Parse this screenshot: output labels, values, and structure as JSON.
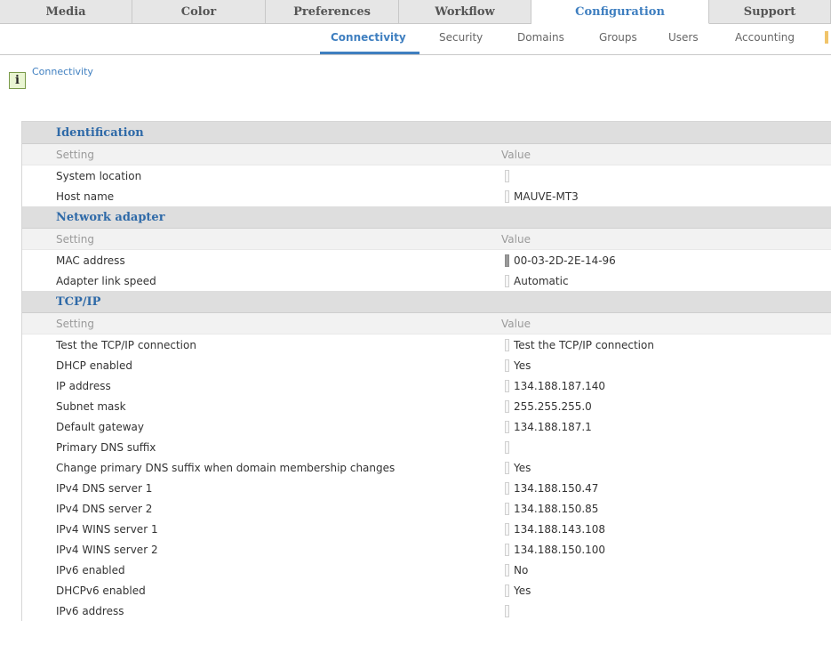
{
  "top_tabs": [
    {
      "label": "Media"
    },
    {
      "label": "Color"
    },
    {
      "label": "Preferences"
    },
    {
      "label": "Workflow"
    },
    {
      "label": "Configuration"
    },
    {
      "label": "Support"
    }
  ],
  "sub_tabs": [
    {
      "label": "Connectivity"
    },
    {
      "label": "Security"
    },
    {
      "label": "Domains"
    },
    {
      "label": "Groups"
    },
    {
      "label": "Users"
    },
    {
      "label": "Accounting"
    }
  ],
  "breadcrumb": "Connectivity",
  "info_icon_glyph": "i",
  "column_headers": {
    "setting": "Setting",
    "value": "Value"
  },
  "sections": [
    {
      "title": "Identification",
      "rows": [
        {
          "label": "System location",
          "value": ""
        },
        {
          "label": "Host name",
          "value": "MAUVE-MT3"
        }
      ]
    },
    {
      "title": "Network adapter",
      "rows": [
        {
          "label": "MAC address",
          "value": "00-03-2D-2E-14-96"
        },
        {
          "label": "Adapter link speed",
          "value": "Automatic"
        }
      ]
    },
    {
      "title": "TCP/IP",
      "rows": [
        {
          "label": "Test the TCP/IP connection",
          "value": "Test the TCP/IP connection"
        },
        {
          "label": "DHCP enabled",
          "value": "Yes"
        },
        {
          "label": "IP address",
          "value": "134.188.187.140"
        },
        {
          "label": "Subnet mask",
          "value": "255.255.255.0"
        },
        {
          "label": "Default gateway",
          "value": "134.188.187.1"
        },
        {
          "label": "Primary DNS suffix",
          "value": ""
        },
        {
          "label": "Change primary DNS suffix when domain membership changes",
          "value": "Yes"
        },
        {
          "label": "IPv4 DNS server 1",
          "value": "134.188.150.47"
        },
        {
          "label": "IPv4 DNS server 2",
          "value": "134.188.150.85"
        },
        {
          "label": "IPv4 WINS server 1",
          "value": "134.188.143.108"
        },
        {
          "label": "IPv4 WINS server 2",
          "value": "134.188.150.100"
        },
        {
          "label": "IPv6 enabled",
          "value": "No"
        },
        {
          "label": "DHCPv6 enabled",
          "value": "Yes"
        },
        {
          "label": "IPv6 address",
          "value": ""
        }
      ]
    }
  ]
}
